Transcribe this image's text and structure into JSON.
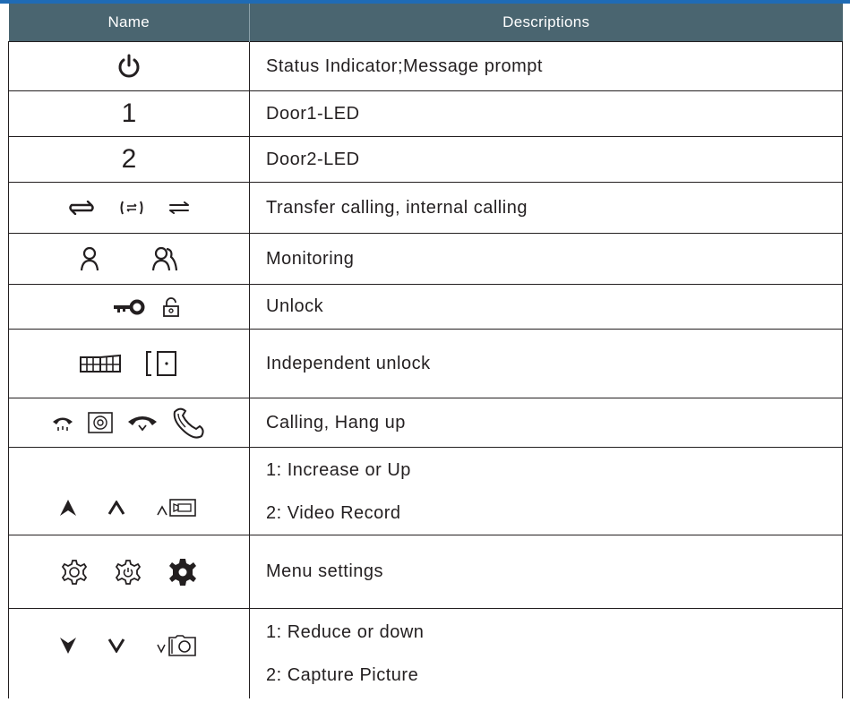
{
  "table": {
    "headers": {
      "name": "Name",
      "descriptions": "Descriptions"
    },
    "rows": [
      {
        "icons": [
          "power-icon"
        ],
        "description": "Status Indicator;Message prompt"
      },
      {
        "label": "1",
        "description": "Door1-LED"
      },
      {
        "label": "2",
        "description": "Door2-LED"
      },
      {
        "icons": [
          "transfer-arrows-icon",
          "bracket-transfer-icon",
          "internal-call-arrows-icon"
        ],
        "description": "Transfer calling, internal calling"
      },
      {
        "icons": [
          "person-icon",
          "persons-icon"
        ],
        "description": "Monitoring"
      },
      {
        "icons": [
          "key-icon",
          "padlock-icon"
        ],
        "description": "Unlock"
      },
      {
        "icons": [
          "gate-icon",
          "door-icon"
        ],
        "description": "Independent unlock"
      },
      {
        "icons": [
          "handset-icon",
          "monitor-icon",
          "handset-down-icon",
          "hangup-handset-icon"
        ],
        "description": "Calling, Hang up"
      },
      {
        "icons": [
          "arrow-up-bold-icon",
          "chevron-up-icon",
          "video-record-icon"
        ],
        "description_lines": [
          "1: Increase or Up",
          "2: Video Record"
        ]
      },
      {
        "icons": [
          "gear-outline-icon",
          "gear-power-icon",
          "gear-solid-icon"
        ],
        "description": "Menu settings"
      },
      {
        "icons": [
          "arrow-down-bold-icon",
          "chevron-down-icon",
          "camera-icon"
        ],
        "description_lines": [
          "1: Reduce or down",
          "2: Capture Picture"
        ]
      }
    ]
  },
  "colors": {
    "header_bg": "#4a6570",
    "header_text": "#ffffff",
    "top_strip": "#1f6bb5",
    "text": "#231f20"
  }
}
